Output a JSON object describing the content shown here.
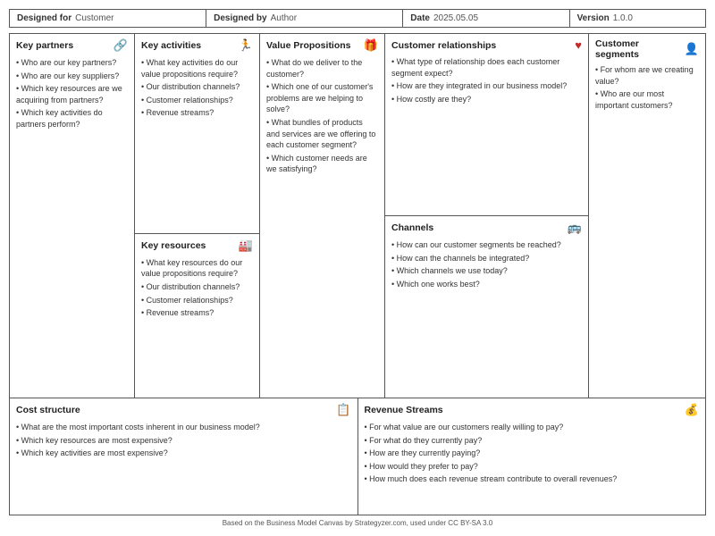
{
  "header": {
    "designed_for_label": "Designed for",
    "designed_for_value": "Customer",
    "designed_by_label": "Designed by",
    "designed_by_value": "Author",
    "date_label": "Date",
    "date_value": "2025.05.05",
    "version_label": "Version",
    "version_value": "1.0.0"
  },
  "sections": {
    "key_partners": {
      "title": "Key partners",
      "icon": "🔗",
      "items": [
        "Who are our key partners?",
        "Who are our key suppliers?",
        "Which key resources are we acquiring from partners?",
        "Which key activities do partners perform?"
      ]
    },
    "key_activities": {
      "title": "Key activities",
      "icon": "🏃",
      "items": [
        "What key activities do our value propositions require?",
        "Our distribution channels?",
        "Customer relationships?",
        "Revenue streams?"
      ]
    },
    "key_resources": {
      "title": "Key resources",
      "icon": "🏭",
      "items": [
        "What key resources do our value propositions require?",
        "Our distribution channels?",
        "Customer relationships?",
        "Revenue streams?"
      ]
    },
    "value_propositions": {
      "title": "Value Propositions",
      "icon": "🎁",
      "items": [
        "What do we deliver to the customer?",
        "Which one of our customer's problems are we helping to solve?",
        "What bundles of products and services are we offering to each customer segment?",
        "Which customer needs are we satisfying?"
      ]
    },
    "customer_relationships": {
      "title": "Customer relationships",
      "icon": "❤️",
      "items": [
        "What type of relationship does each customer segment expect?",
        "How are they integrated in our business model?",
        "How costly are they?"
      ]
    },
    "channels": {
      "title": "Channels",
      "icon": "🚌",
      "items": [
        "How can our customer segments be reached?",
        "How can the channels be integrated?",
        "Which channels we use today?",
        "Which one works best?"
      ]
    },
    "customer_segments": {
      "title": "Customer segments",
      "icon": "👤",
      "items": [
        "For whom are we creating value?",
        "Who are our most important customers?"
      ]
    },
    "cost_structure": {
      "title": "Cost structure",
      "icon": "📋",
      "items": [
        "What are the most important costs inherent in our business model?",
        "Which key resources are most expensive?",
        "Which key activities are most expensive?"
      ]
    },
    "revenue_streams": {
      "title": "Revenue Streams",
      "icon": "💰",
      "items": [
        "For what value are our customers really willing to pay?",
        "For what do they currently pay?",
        "How are they currently paying?",
        "How would they prefer to pay?",
        "How much does each revenue stream contribute to overall revenues?"
      ]
    }
  },
  "footer": {
    "text": "Based on the Business Model Canvas by Strategyzer.com, used under CC BY-SA 3.0"
  }
}
